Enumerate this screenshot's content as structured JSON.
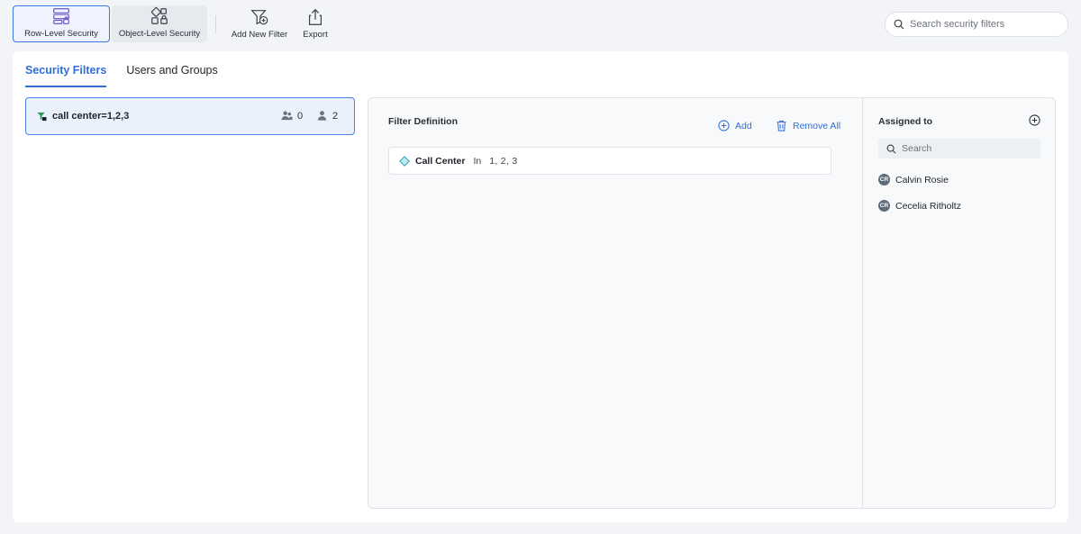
{
  "toolbar": {
    "row_level_security": "Row-Level Security",
    "object_level_security": "Object-Level Security",
    "add_new_filter": "Add New Filter",
    "export": "Export",
    "search_placeholder": "Search security filters"
  },
  "tabs": [
    {
      "label": "Security Filters",
      "active": true
    },
    {
      "label": "Users and Groups",
      "active": false
    }
  ],
  "filters": [
    {
      "name": "call center=1,2,3",
      "groups_count": "0",
      "users_count": "2"
    }
  ],
  "definition": {
    "title": "Filter Definition",
    "add_label": "Add",
    "remove_all_label": "Remove All",
    "conditions": [
      {
        "field": "Call Center",
        "operator": "In",
        "values": "1, 2, 3"
      }
    ]
  },
  "assigned": {
    "title": "Assigned to",
    "search_placeholder": "Search",
    "users": [
      {
        "initials": "CR",
        "name": "Calvin Rosie"
      },
      {
        "initials": "CR",
        "name": "Cecelia Ritholtz"
      }
    ]
  },
  "colors": {
    "accent": "#2f6fd6",
    "selected_bg": "#eaf1fc",
    "filter_icon": "#2e9b5b",
    "attribute_icon": "#2aa6b8"
  }
}
